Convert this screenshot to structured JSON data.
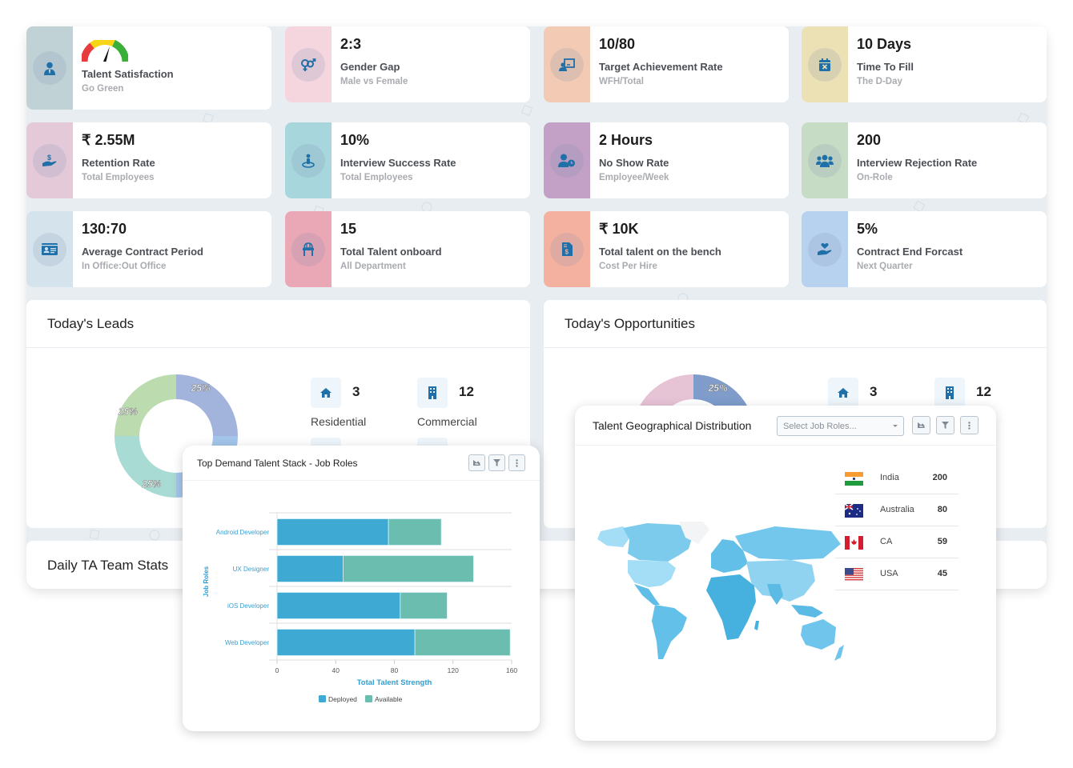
{
  "colors": {
    "icon_blue": "#1f6fa8",
    "deployed": "#3eaad4",
    "available": "#6bbeaf",
    "axis_label": "#2e9fd2"
  },
  "kpis": [
    {
      "value": "",
      "label": "Talent Satisfaction",
      "sub": "Go Green",
      "icon": "user-tie-icon",
      "side_color": "#c0d2d6",
      "gauge": true
    },
    {
      "value": "2:3",
      "label": "Gender Gap",
      "sub": "Male vs Female",
      "icon": "gender-icon",
      "side_color": "#f5d6de"
    },
    {
      "value": "10/80",
      "label": "Target Achievement Rate",
      "sub": "WFH/Total",
      "icon": "presentation-icon",
      "side_color": "#f3cbb4"
    },
    {
      "value": "10 Days",
      "label": "Time To Fill",
      "sub": "The D-Day",
      "icon": "calendar-x-icon",
      "side_color": "#ece1b4"
    },
    {
      "value": "₹ 2.55M",
      "label": "Retention Rate",
      "sub": "Total Employees",
      "icon": "hand-dollar-icon",
      "side_color": "#e4cad8"
    },
    {
      "value": "10%",
      "label": "Interview Success Rate",
      "sub": "Total Employees",
      "icon": "person-pin-icon",
      "side_color": "#a7d6dc"
    },
    {
      "value": "2 Hours",
      "label": "No Show Rate",
      "sub": "Employee/Week",
      "icon": "user-clock-icon",
      "side_color": "#c3a1c6"
    },
    {
      "value": "200",
      "label": "Interview Rejection Rate",
      "sub": "On-Role",
      "icon": "users-icon",
      "side_color": "#c7dcc5"
    },
    {
      "value": "130:70",
      "label": "Average Contract Period",
      "sub": "In Office:Out Office",
      "icon": "id-card-icon",
      "side_color": "#d5e4ec"
    },
    {
      "value": "15",
      "label": "Total Talent onboard",
      "sub": "All Department",
      "icon": "chair-icon",
      "side_color": "#eaa7b5"
    },
    {
      "value": "₹ 10K",
      "label": "Total talent on the bench",
      "sub": "Cost Per Hire",
      "icon": "invoice-dollar-icon",
      "side_color": "#f4b1a0"
    },
    {
      "value": "5%",
      "label": "Contract End Forcast",
      "sub": "Next Quarter",
      "icon": "hand-heart-icon",
      "side_color": "#b6d2ef"
    }
  ],
  "leads": {
    "title": "Today's Leads",
    "donut": [
      {
        "label": "25%",
        "value": 25,
        "color": "#a2b3dc"
      },
      {
        "label": "",
        "value": 25,
        "color": "#a3c5ea"
      },
      {
        "label": "25%",
        "value": 25,
        "color": "#a8dbd3"
      },
      {
        "label": "25%",
        "value": 25,
        "color": "#bcdcb0"
      }
    ],
    "stats": [
      {
        "num": "3",
        "label": "Residential",
        "icon": "home-icon"
      },
      {
        "num": "12",
        "label": "Commercial",
        "icon": "building-icon"
      }
    ]
  },
  "opportunities": {
    "title": "Today's Opportunities",
    "donut": [
      {
        "label": "25%",
        "value": 25,
        "color": "#7f9ccb"
      },
      {
        "label": "25%",
        "value": 25,
        "color": "#e7c3d6"
      }
    ],
    "stats": [
      {
        "num": "3",
        "label": "",
        "icon": "home-icon"
      },
      {
        "num": "12",
        "label": "",
        "icon": "building-icon"
      }
    ]
  },
  "daily_stats": {
    "title": "Daily TA Team Stats"
  },
  "talent_stack": {
    "title": "Top Demand Talent Stack - Job Roles",
    "buttons": [
      "chart-type-button",
      "filter-button",
      "more-button"
    ]
  },
  "chart_data": {
    "type": "bar",
    "orientation": "horizontal",
    "stacked": true,
    "title": "Top Demand Talent Stack - Job Roles",
    "categories": [
      "Android Developer",
      "UX Designer",
      "iOS Developer",
      "Web Developer"
    ],
    "series": [
      {
        "name": "Deployed",
        "values": [
          76,
          45,
          84,
          94
        ],
        "color": "#3eaad4"
      },
      {
        "name": "Available",
        "values": [
          36,
          89,
          32,
          65
        ],
        "color": "#6bbeaf"
      }
    ],
    "xlabel": "Total Talent Strength",
    "ylabel": "Job Roles",
    "xlim": [
      0,
      160
    ],
    "xticks": [
      "0",
      "40",
      "80",
      "120",
      "160"
    ],
    "grid": true,
    "legend": "bottom-center"
  },
  "geo": {
    "title": "Talent Geographical Distribution",
    "select_placeholder": "Select Job Roles...",
    "countries": [
      {
        "name": "India",
        "value": "200",
        "flag": "india-flag-icon"
      },
      {
        "name": "Australia",
        "value": "80",
        "flag": "australia-flag-icon"
      },
      {
        "name": "CA",
        "value": "59",
        "flag": "canada-flag-icon"
      },
      {
        "name": "USA",
        "value": "45",
        "flag": "usa-flag-icon"
      }
    ]
  }
}
